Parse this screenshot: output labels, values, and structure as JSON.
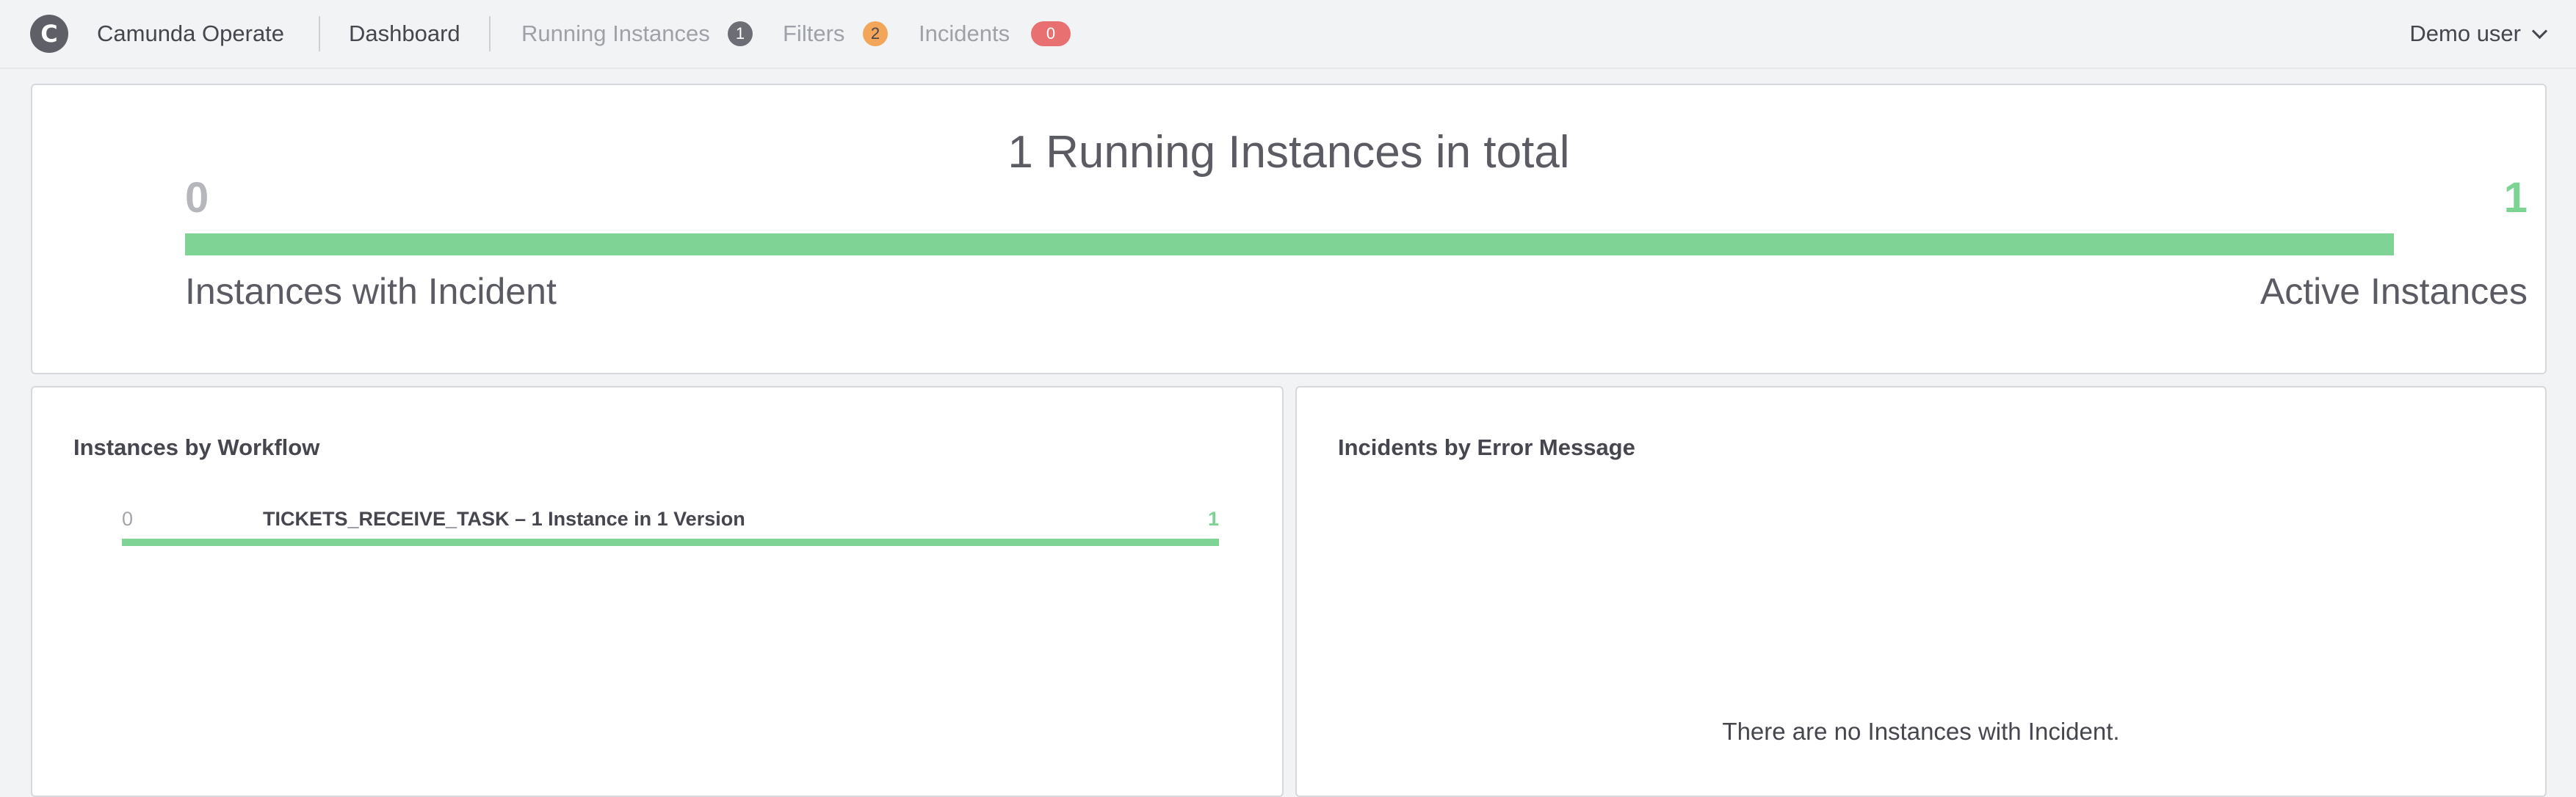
{
  "header": {
    "logo_letter": "C",
    "brand": "Camunda Operate",
    "nav": {
      "dashboard": "Dashboard",
      "running_instances": "Running Instances",
      "running_instances_count": "1",
      "filters": "Filters",
      "filters_count": "2",
      "incidents": "Incidents",
      "incidents_count": "0"
    },
    "user": "Demo user"
  },
  "metric_panel": {
    "title": "1 Running Instances in total",
    "incident_count": "0",
    "active_count": "1",
    "incident_label": "Instances with Incident",
    "active_label": "Active Instances",
    "active_fraction": 1.0
  },
  "workflow_panel": {
    "title": "Instances by Workflow",
    "rows": [
      {
        "incidents": "0",
        "name": "TICKETS_RECEIVE_TASK – 1 Instance in 1 Version",
        "active": "1",
        "active_fraction": 1.0
      }
    ]
  },
  "incidents_panel": {
    "title": "Incidents by Error Message",
    "empty_message": "There are no Instances with Incident."
  },
  "colors": {
    "active": "#7fd495",
    "incident": "#e97070",
    "filters_badge": "#f3a55a",
    "running_badge": "#6d6e75"
  }
}
